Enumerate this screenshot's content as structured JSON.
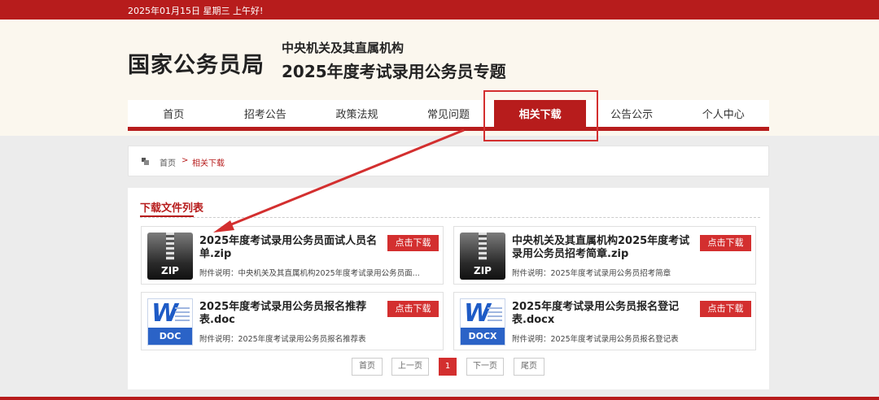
{
  "topbar": {
    "date_text": "2025年01月15日  星期三  上午好!"
  },
  "header": {
    "logo": "国家公务员局",
    "subtitle_1": "中央机关及其直属机构",
    "subtitle_2": "2025年度考试录用公务员专题"
  },
  "nav": {
    "items": [
      {
        "label": "首页"
      },
      {
        "label": "招考公告"
      },
      {
        "label": "政策法规"
      },
      {
        "label": "常见问题"
      },
      {
        "label": "相关下载"
      },
      {
        "label": "公告公示"
      },
      {
        "label": "个人中心"
      }
    ],
    "active_index": 4
  },
  "breadcrumb": {
    "home": "首页",
    "separator": ">",
    "current": "相关下载"
  },
  "panel": {
    "title": "下载文件列表"
  },
  "downloads": [
    {
      "name": "2025年度考试录用公务员面试人员名单.zip",
      "desc": "附件说明：中央机关及其直属机构2025年度考试录用公务员面...",
      "type": "ZIP",
      "button": "点击下载"
    },
    {
      "name": "中央机关及其直属机构2025年度考试录用公务员招考简章.zip",
      "desc": "附件说明：2025年度考试录用公务员招考简章",
      "type": "ZIP",
      "button": "点击下载"
    },
    {
      "name": "2025年度考试录用公务员报名推荐表.doc",
      "desc": "附件说明：2025年度考试录用公务员报名推荐表",
      "type": "DOC",
      "button": "点击下载"
    },
    {
      "name": "2025年度考试录用公务员报名登记表.docx",
      "desc": "附件说明：2025年度考试录用公务员报名登记表",
      "type": "DOCX",
      "button": "点击下载"
    }
  ],
  "pager": {
    "first": "首页",
    "prev": "上一页",
    "current": "1",
    "next": "下一页",
    "last": "尾页"
  },
  "colors": {
    "brand_red": "#b71c1c",
    "button_red": "#d32f2f",
    "header_bg": "#fbf7ee"
  }
}
